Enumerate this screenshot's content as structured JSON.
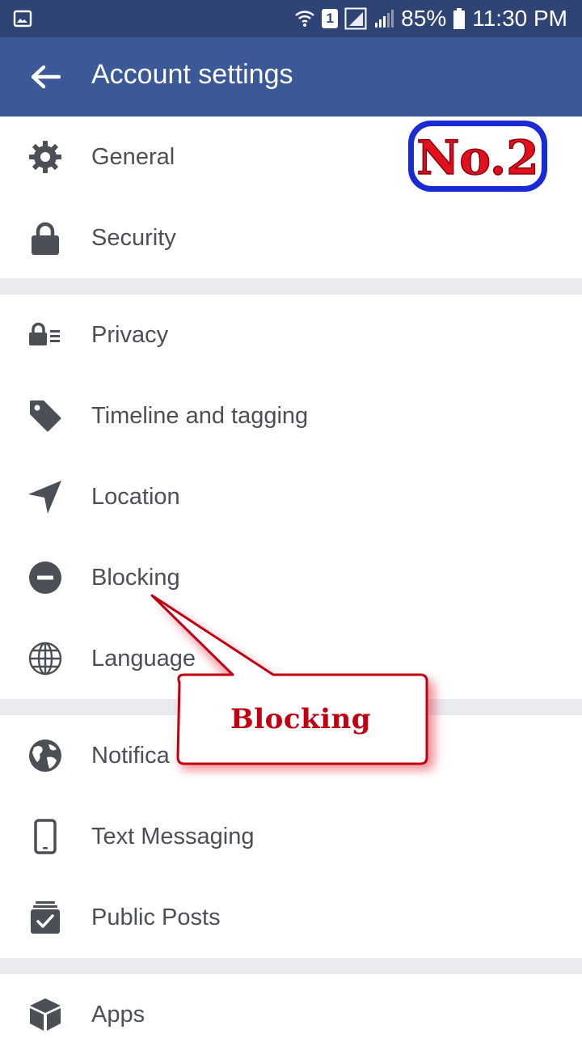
{
  "status_bar": {
    "battery": "85%",
    "time": "11:30 PM",
    "sim": "1"
  },
  "header": {
    "title": "Account settings",
    "back_icon": "arrow-left-icon"
  },
  "groups": [
    {
      "items": [
        {
          "label": "General",
          "icon": "gear-icon"
        },
        {
          "label": "Security",
          "icon": "lock-icon"
        }
      ]
    },
    {
      "items": [
        {
          "label": "Privacy",
          "icon": "lock-list-icon"
        },
        {
          "label": "Timeline and tagging",
          "icon": "tag-icon"
        },
        {
          "label": "Location",
          "icon": "location-arrow-icon"
        },
        {
          "label": "Blocking",
          "icon": "minus-circle-icon"
        },
        {
          "label": "Language",
          "icon": "globe-icon"
        }
      ]
    },
    {
      "items": [
        {
          "label": "Notifica",
          "icon": "earth-icon"
        },
        {
          "label": "Text Messaging",
          "icon": "phone-icon"
        },
        {
          "label": "Public Posts",
          "icon": "checklist-icon"
        }
      ]
    },
    {
      "items": [
        {
          "label": "Apps",
          "icon": "box-icon"
        }
      ]
    }
  ],
  "overlays": {
    "badge_text": "No.2",
    "callout_text": "Blocking"
  },
  "colors": {
    "status_bar": "#2f4474",
    "header": "#3b5998",
    "divider": "#e9ebee",
    "icon": "#4b4f56",
    "callout_red": "#c00012",
    "badge_blue": "#1a2bd6"
  }
}
